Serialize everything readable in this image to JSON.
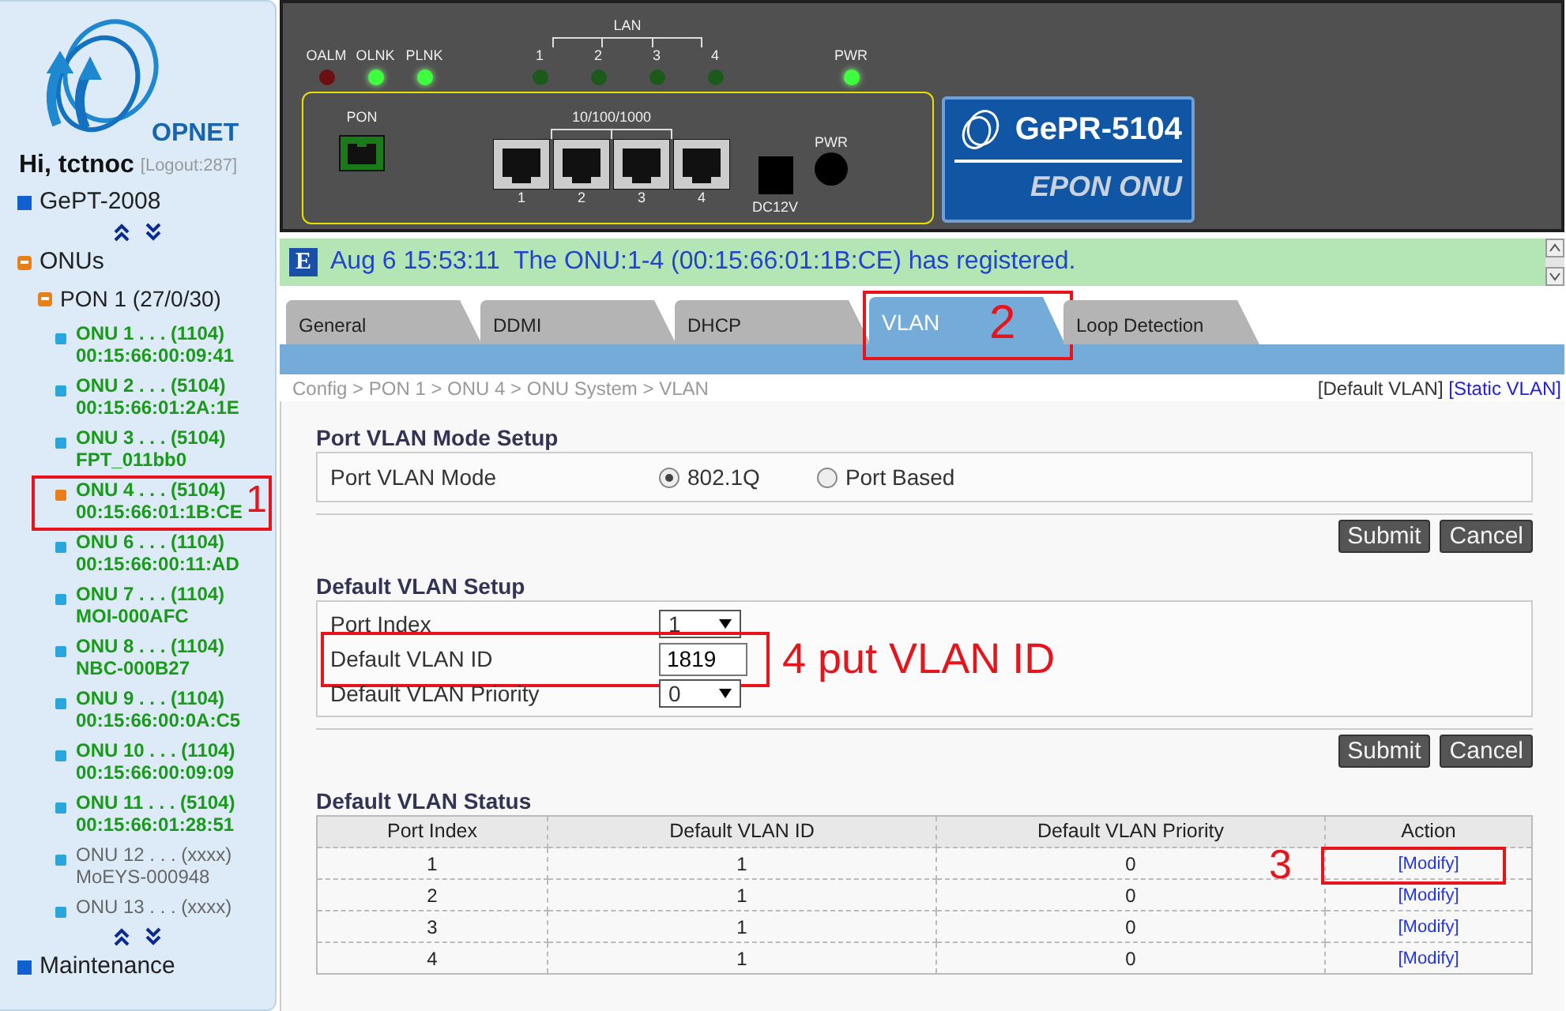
{
  "sidebar": {
    "logo_text": "OPNET",
    "greeting": "Hi, tctnoc",
    "logout": "[Logout:287]",
    "tree": [
      {
        "label": "GePT-2008",
        "expanded": false
      },
      {
        "label": "ONUs",
        "expanded": true,
        "children": [
          {
            "label": "PON 1 (27/0/30)",
            "expanded": true,
            "children": [
              {
                "label": "ONU 1 . . . (1104)",
                "detail": "00:15:66:00:09:41",
                "online": true,
                "selected": false
              },
              {
                "label": "ONU 2 . . . (5104)",
                "detail": "00:15:66:01:2A:1E",
                "online": true,
                "selected": false
              },
              {
                "label": "ONU 3 . . . (5104)",
                "detail": "FPT_011bb0",
                "online": true,
                "selected": false
              },
              {
                "label": "ONU 4 . . . (5104)",
                "detail": "00:15:66:01:1B:CE",
                "online": true,
                "selected": true,
                "annotation": "1"
              },
              {
                "label": "ONU 6 . . . (1104)",
                "detail": "00:15:66:00:11:AD",
                "online": true,
                "selected": false
              },
              {
                "label": "ONU 7 . . . (1104)",
                "detail": "MOI-000AFC",
                "online": true,
                "selected": false
              },
              {
                "label": "ONU 8 . . . (1104)",
                "detail": "NBC-000B27",
                "online": true,
                "selected": false
              },
              {
                "label": "ONU 9 . . . (1104)",
                "detail": "00:15:66:00:0A:C5",
                "online": true,
                "selected": false
              },
              {
                "label": "ONU 10 . . . (1104)",
                "detail": "00:15:66:00:09:09",
                "online": true,
                "selected": false
              },
              {
                "label": "ONU 11 . . . (5104)",
                "detail": "00:15:66:01:28:51",
                "online": true,
                "selected": false
              },
              {
                "label": "ONU 12 . . . (xxxx)",
                "detail": "MoEYS-000948",
                "online": false,
                "selected": false
              },
              {
                "label": "ONU 13 . . . (xxxx)",
                "online": false,
                "selected": false
              }
            ]
          }
        ]
      },
      {
        "label": "Maintenance",
        "expanded": false
      }
    ]
  },
  "device": {
    "leds": [
      {
        "label": "OALM",
        "kind": "alarm",
        "on": false
      },
      {
        "label": "OLNK",
        "kind": "link",
        "on": true
      },
      {
        "label": "PLNK",
        "kind": "link",
        "on": true
      }
    ],
    "lan": {
      "label": "LAN",
      "leds": [
        {
          "label": "1",
          "on": false
        },
        {
          "label": "2",
          "on": false
        },
        {
          "label": "3",
          "on": false
        },
        {
          "label": "4",
          "on": false
        }
      ]
    },
    "power_led": {
      "label": "PWR",
      "on": true
    },
    "pon_label": "PON",
    "ethernet_label": "10/100/1000",
    "ports": [
      "1",
      "2",
      "3",
      "4"
    ],
    "dc_label": "DC12V",
    "power_label": "PWR",
    "model": "GePR-5104",
    "type": "EPON ONU"
  },
  "event": {
    "badge": "E",
    "message": "Aug 6 15:53:11  The ONU:1-4 (00:15:66:01:1B:CE) has registered."
  },
  "tabs": [
    {
      "label": "General",
      "selected": false
    },
    {
      "label": "DDMI",
      "selected": false
    },
    {
      "label": "DHCP",
      "selected": false
    },
    {
      "label": "VLAN",
      "selected": true,
      "annotation": "2"
    },
    {
      "label": "Loop Detection",
      "selected": false
    }
  ],
  "breadcrumb": "Config > PON 1 > ONU 4 > ONU System > VLAN",
  "view_links": [
    {
      "label": "[Default VLAN]",
      "selected": true
    },
    {
      "label": "[Static VLAN]",
      "selected": false
    }
  ],
  "mode_setup": {
    "title": "Port VLAN Mode Setup",
    "label": "Port VLAN Mode",
    "options": [
      {
        "label": "802.1Q",
        "selected": true
      },
      {
        "label": "Port Based",
        "selected": false
      }
    ],
    "buttons": [
      "Submit",
      "Cancel"
    ]
  },
  "default_setup": {
    "title": "Default VLAN Setup",
    "fields": [
      {
        "kind": "select",
        "label": "Port Index",
        "value": "1"
      },
      {
        "kind": "input",
        "label": "Default VLAN ID",
        "value": "1819",
        "annotation": "4 put VLAN ID"
      },
      {
        "kind": "select",
        "label": "Default VLAN Priority",
        "value": "0"
      }
    ],
    "buttons": [
      "Submit",
      "Cancel"
    ]
  },
  "status": {
    "title": "Default VLAN Status",
    "columns": [
      "Port Index",
      "Default VLAN ID",
      "Default VLAN Priority",
      "Action"
    ],
    "rows": [
      {
        "cells": [
          "1",
          "1",
          "0"
        ],
        "action": "[Modify]",
        "annotation": "3"
      },
      {
        "cells": [
          "2",
          "1",
          "0"
        ],
        "action": "[Modify]"
      },
      {
        "cells": [
          "3",
          "1",
          "0"
        ],
        "action": "[Modify]"
      },
      {
        "cells": [
          "4",
          "1",
          "0"
        ],
        "action": "[Modify]"
      }
    ]
  }
}
